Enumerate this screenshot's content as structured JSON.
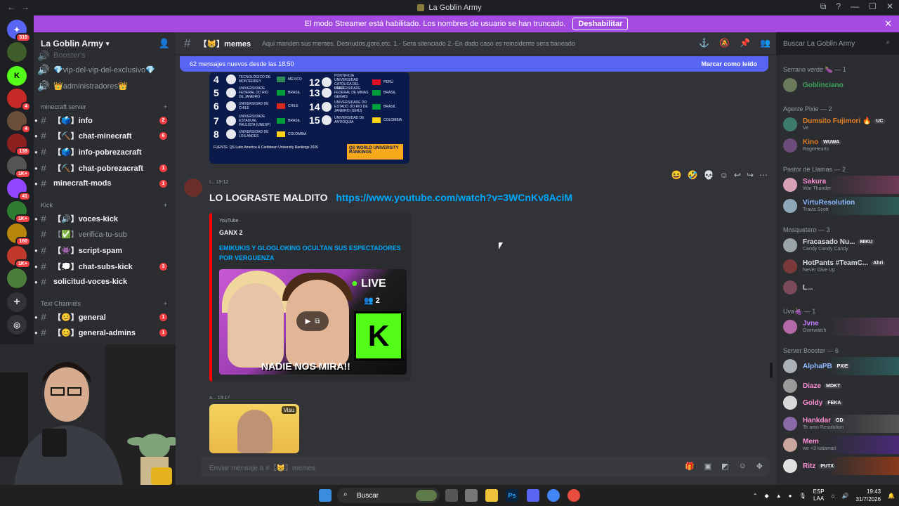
{
  "window": {
    "title": "La Goblin Army",
    "controls": [
      "⧉",
      "?",
      "—",
      "☐",
      "✕"
    ]
  },
  "streamer_banner": {
    "text": "El modo Streamer está habilitado. Los nombres de usuario se han truncado.",
    "button": "Deshabilitar"
  },
  "server_rail": {
    "badges": [
      "519",
      "4",
      "4",
      "139",
      "1K+",
      "41",
      "1K+",
      "160",
      "1K+"
    ]
  },
  "server": {
    "name": "La Goblin Army"
  },
  "sidebar": {
    "top_items": [
      {
        "label": "Booster's"
      },
      {
        "label": "💎vip-del-vip-del-exclusivo💎"
      },
      {
        "label": "👑administradores👑"
      }
    ],
    "categories": [
      {
        "label": "minecraft server"
      },
      {
        "label": "Kick"
      },
      {
        "label": "Text Channels"
      }
    ],
    "channels": [
      {
        "label": "【🗳️】info",
        "count": "2"
      },
      {
        "label": "【⛏️】chat-minecraft",
        "count": "6"
      },
      {
        "label": "【🗳️】info-pobrezacraft",
        "count": ""
      },
      {
        "label": "【⛏️】chat-pobrezacraft",
        "count": "1"
      },
      {
        "label": "minecraft-mods",
        "count": "1"
      },
      {
        "label": "【🔊】voces-kick",
        "count": ""
      },
      {
        "label": "【✅】verifica-tu-sub",
        "count": ""
      },
      {
        "label": "【👾】script-spam",
        "count": ""
      },
      {
        "label": "【💭】chat-subs-kick",
        "count": "3"
      },
      {
        "label": "solicitud-voces-kick",
        "count": ""
      },
      {
        "label": "【😊】general",
        "count": "1"
      },
      {
        "label": "【😊】general-admins",
        "count": "1"
      }
    ]
  },
  "chat_header": {
    "channel": "【😸】memes",
    "topic": "Aqui manden sus memes. Desnudos,gore,etc. 1.- Sera silenciado 2.-En dado caso es reincidente sera baneado"
  },
  "search": {
    "placeholder": "Buscar La Goblin Army"
  },
  "new_messages": {
    "text": "62 mensajes nuevos desde las 18:50",
    "action": "Marcar como leído"
  },
  "ranking_image": {
    "rows": [
      {
        "rank": "4",
        "name": "TECNOLÓGICO DE MONTERREY",
        "country": "MÉXICO"
      },
      {
        "rank": "5",
        "name": "UNIVERSIDADE FEDERAL DO RIO DE JANEIRO",
        "country": "BRASIL"
      },
      {
        "rank": "6",
        "name": "UNIVERSIDAD DE CHILE",
        "country": "CHILE"
      },
      {
        "rank": "7",
        "name": "UNIVERSIDADE ESTADUAL PAULISTA (UNESP)",
        "country": "BRASIL"
      },
      {
        "rank": "8",
        "name": "UNIVERSIDAD DE LOS ANDES",
        "country": "COLOMBIA"
      },
      {
        "rank": "12",
        "name": "PONTIFICIA UNIVERSIDAD CATÓLICA DEL PERÚ",
        "country": "PERÚ"
      },
      {
        "rank": "13",
        "name": "UNIVERSIDADE FEDERAL DE MINAS GERAIS",
        "country": "BRASIL"
      },
      {
        "rank": "14",
        "name": "UNIVERSIDADE DO ESTADO DO RIO DE JANEIRO (UERJ)",
        "country": "BRASIL"
      },
      {
        "rank": "15",
        "name": "UNIVERSIDAD DE ANTIOQUIA",
        "country": "COLOMBIA"
      }
    ],
    "source": "FUENTE: QS Latin America & Caribbean University Rankings 2026",
    "brand": "QS WORLD UNIVERSITY RANKINGS"
  },
  "message1": {
    "author": "I...",
    "time": "19:12",
    "text": "LO LOGRASTE MALDITO",
    "link": "https://www.youtube.com/watch?v=3WCnKv8AciM",
    "embed": {
      "provider": "YouTube",
      "author": "GANX 2",
      "title": "EMIKUKIS Y GLOGLOKING OCULTAN SUS ESPECTADORES POR VERGUENZA",
      "thumb_live": "LIVE",
      "thumb_count": "2",
      "thumb_caption": "NADIE NOS MIRA!!"
    }
  },
  "message2": {
    "author": "a...",
    "time": "19:17",
    "image_tag": "Visu"
  },
  "composer": {
    "placeholder": "Enviar mensaje a #【😸】memes"
  },
  "members": {
    "groups": [
      {
        "label": "Serrano verde 🍆 — 1"
      },
      {
        "label": "Agente Pixie — 2"
      },
      {
        "label": "Pastor de Llamas — 2"
      },
      {
        "label": "Mosquetero — 3"
      },
      {
        "label": "Uva🍇 — 1"
      },
      {
        "label": "Server Booster — 6"
      }
    ],
    "list": [
      {
        "name": "Goblinciano",
        "tag": "",
        "sub": "",
        "color": "#3ba55d"
      },
      {
        "name": "Dumsito Fujimori 🔥",
        "tag": "UC",
        "sub": "Ve",
        "color": "#e67e22"
      },
      {
        "name": "Kino",
        "tag": "WUWA",
        "sub": "RageHearts",
        "color": "#e67e22"
      },
      {
        "name": "Sakura",
        "tag": "",
        "sub": "War Thunder",
        "color": "#ff8fd6"
      },
      {
        "name": "VirtuResolution",
        "tag": "",
        "sub": "Travis Scott",
        "color": "#8fb9ff"
      },
      {
        "name": "Fracasado Nu...",
        "tag": "MIKU",
        "sub": "Candy Candy Candy",
        "color": "#dbdee1"
      },
      {
        "name": "HotPants #TeamC...",
        "tag": "Ahri",
        "sub": "Never Give Up",
        "color": "#dbdee1"
      },
      {
        "name": "L...",
        "tag": "",
        "sub": "",
        "color": "#dbdee1"
      },
      {
        "name": "Jvne",
        "tag": "",
        "sub": "Overwatch",
        "color": "#c77dff"
      },
      {
        "name": "AlphaPB",
        "tag": "PXIE",
        "sub": "",
        "color": "#8fb9ff"
      },
      {
        "name": "Diaze",
        "tag": "MDKT",
        "sub": "",
        "color": "#ff8fd6"
      },
      {
        "name": "Goldy",
        "tag": "FEKA",
        "sub": "",
        "color": "#ff8fd6"
      },
      {
        "name": "Hankdar",
        "tag": "GD",
        "sub": "Te amo Resolution",
        "color": "#ff8fd6"
      },
      {
        "name": "Mem",
        "tag": "",
        "sub": "we <3 katamari",
        "color": "#ff8fd6"
      },
      {
        "name": "Ritz",
        "tag": "PUTX",
        "sub": "",
        "color": "#ff8fd6"
      }
    ]
  },
  "taskbar": {
    "search": "Buscar",
    "lang_top": "ESP",
    "lang_bottom": "LAA",
    "time": "19:43",
    "date": "31/7/2026"
  },
  "colors": {
    "accent": "#5865f2",
    "banner": "#a44be2",
    "link": "#00a8fc",
    "unread_badge": "#f23f43"
  }
}
